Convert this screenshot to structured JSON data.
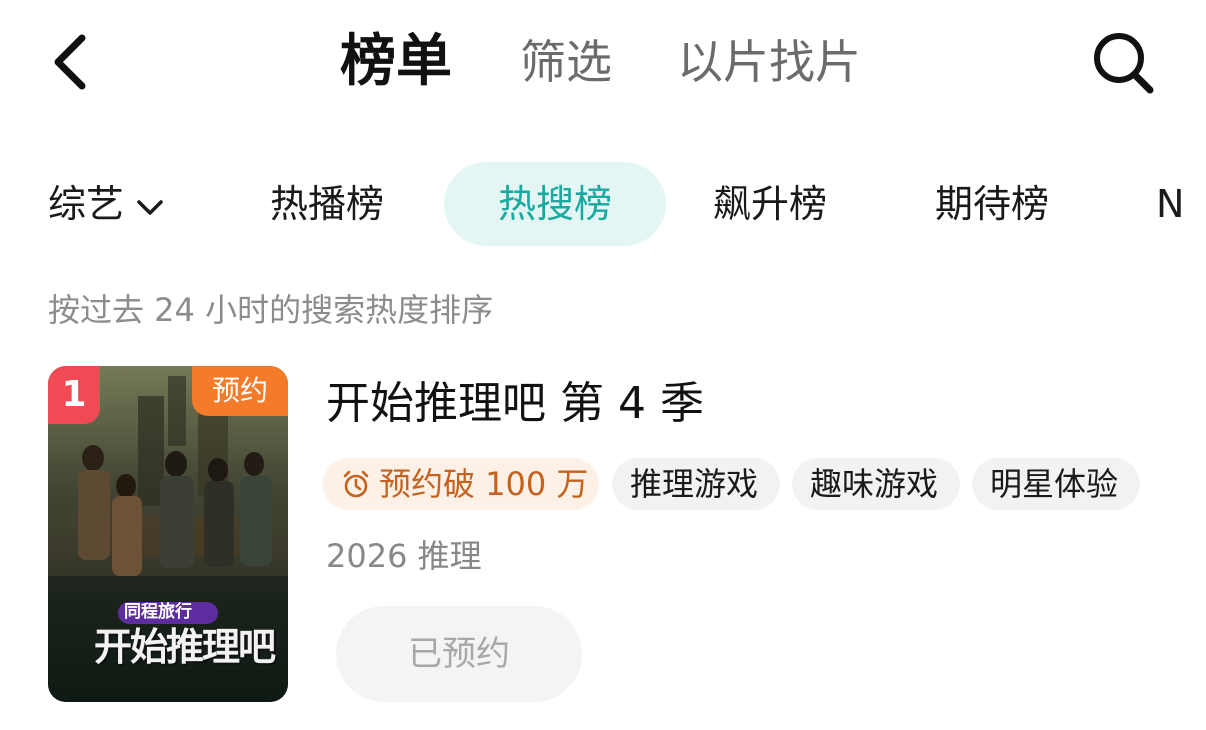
{
  "nav": {
    "back_icon": "chevron-left-icon",
    "tabs": [
      {
        "label": "榜单",
        "active": true
      },
      {
        "label": "筛选",
        "active": false
      },
      {
        "label": "以片找片",
        "active": false
      }
    ],
    "search_icon": "search-icon"
  },
  "categories": {
    "selector_label": "综艺",
    "tabs": [
      {
        "label": "热播榜",
        "active": false
      },
      {
        "label": "热搜榜",
        "active": true
      },
      {
        "label": "飙升榜",
        "active": false
      },
      {
        "label": "期待榜",
        "active": false
      },
      {
        "label": "N",
        "active": false
      }
    ]
  },
  "subtitle": "按过去 24 小时的搜索热度排序",
  "items": [
    {
      "rank": "1",
      "poster_badge": "预约",
      "poster_sponsor": "同程旅行",
      "poster_logo": "开始推理吧",
      "title": "开始推理吧 第 4 季",
      "reserve_count": "预约破 100 万",
      "tags": [
        "推理游戏",
        "趣味游戏",
        "明星体验"
      ],
      "meta": "2026 推理",
      "button_label": "已预约"
    }
  ],
  "colors": {
    "accent": "#19a9a0",
    "accent_bg": "#e3f6f4",
    "rank_badge": "#f04b55",
    "reserve_badge": "#f47b2a",
    "reserve_chip_text": "#c4621e",
    "reserve_chip_bg": "#fdf0e6"
  }
}
